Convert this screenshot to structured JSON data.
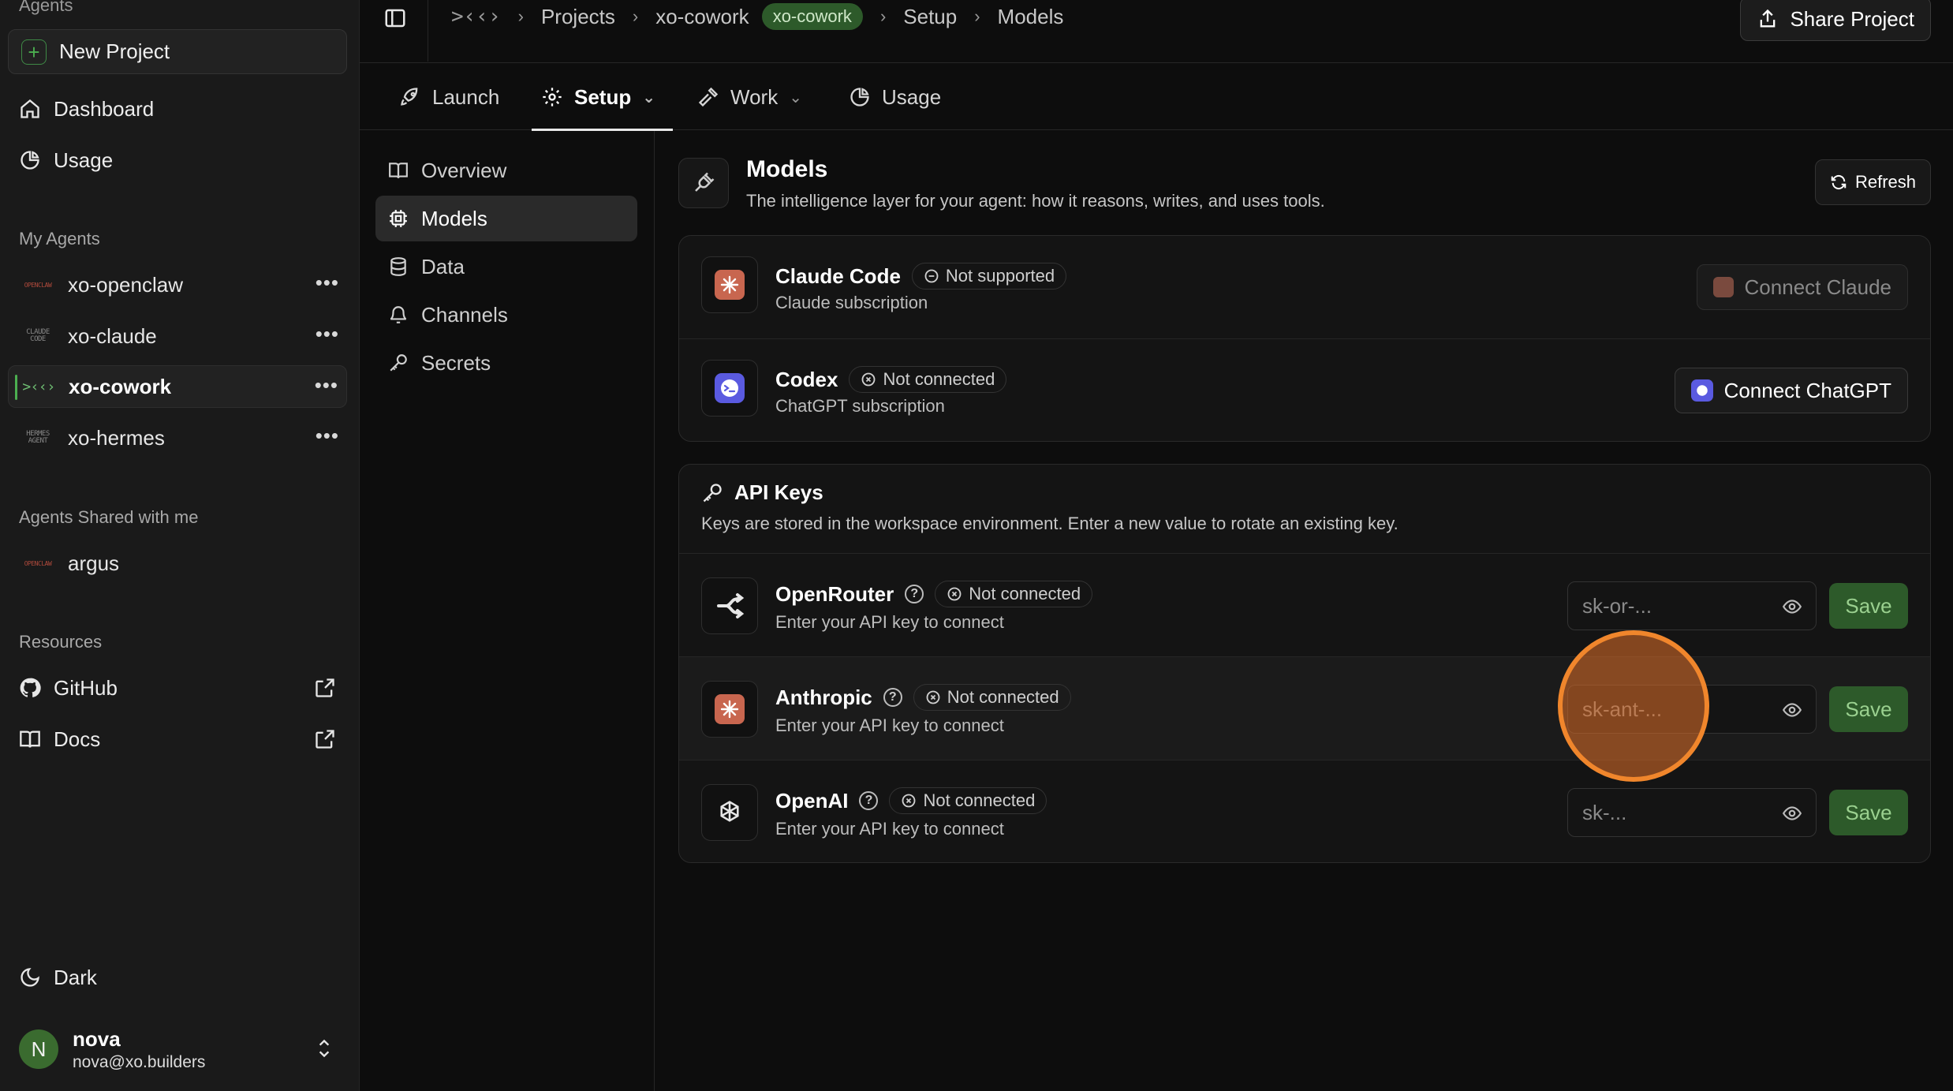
{
  "sidebar": {
    "top_heading": "Agents",
    "new_project": "New Project",
    "nav": [
      {
        "label": "Dashboard",
        "icon": "home-icon"
      },
      {
        "label": "Usage",
        "icon": "pie-chart-icon"
      }
    ],
    "my_agents_heading": "My Agents",
    "agents": [
      {
        "name": "xo-openclaw",
        "logo": "OPENCLAW"
      },
      {
        "name": "xo-claude",
        "logo": "CLAUDE CODE"
      },
      {
        "name": "xo-cowork",
        "logo": ">‹‹›"
      },
      {
        "name": "xo-hermes",
        "logo": "HERMES AGENT"
      }
    ],
    "shared_heading": "Agents Shared with me",
    "shared_agents": [
      {
        "name": "argus",
        "logo": "OPENCLAW"
      }
    ],
    "resources_heading": "Resources",
    "resources": [
      {
        "label": "GitHub",
        "icon": "github-icon"
      },
      {
        "label": "Docs",
        "icon": "book-icon"
      }
    ],
    "theme_label": "Dark",
    "user": {
      "initial": "N",
      "name": "nova",
      "email": "nova@xo.builders"
    }
  },
  "topbar": {
    "logo": ">‹‹›",
    "breadcrumbs": [
      "Projects",
      "xo-cowork",
      "Setup",
      "Models"
    ],
    "project_pill": "xo-cowork",
    "share_label": "Share Project"
  },
  "tabs": [
    {
      "label": "Launch",
      "icon": "rocket-icon"
    },
    {
      "label": "Setup",
      "icon": "gear-icon",
      "active": true
    },
    {
      "label": "Work",
      "icon": "hammer-icon"
    },
    {
      "label": "Usage",
      "icon": "pie-chart-icon"
    }
  ],
  "subnav": [
    {
      "label": "Overview",
      "icon": "book-icon"
    },
    {
      "label": "Models",
      "icon": "cpu-icon",
      "active": true
    },
    {
      "label": "Data",
      "icon": "database-icon"
    },
    {
      "label": "Channels",
      "icon": "bell-icon"
    },
    {
      "label": "Secrets",
      "icon": "key-icon"
    }
  ],
  "main": {
    "title": "Models",
    "subtitle": "The intelligence layer for your agent: how it reasons, writes, and uses tools.",
    "refresh_label": "Refresh",
    "subscriptions": [
      {
        "name": "Claude Code",
        "status": "Not supported",
        "subtitle": "Claude subscription",
        "action": "Connect Claude"
      },
      {
        "name": "Codex",
        "status": "Not connected",
        "subtitle": "ChatGPT subscription",
        "action": "Connect ChatGPT"
      }
    ],
    "api_keys": {
      "title": "API Keys",
      "subtitle": "Keys are stored in the workspace environment. Enter a new value to rotate an existing key.",
      "providers": [
        {
          "name": "OpenRouter",
          "status": "Not connected",
          "subtitle": "Enter your API key to connect",
          "placeholder": "sk-or-...",
          "save": "Save"
        },
        {
          "name": "Anthropic",
          "status": "Not connected",
          "subtitle": "Enter your API key to connect",
          "placeholder": "sk-ant-...",
          "save": "Save"
        },
        {
          "name": "OpenAI",
          "status": "Not connected",
          "subtitle": "Enter your API key to connect",
          "placeholder": "sk-...",
          "save": "Save"
        }
      ]
    }
  },
  "colors": {
    "accent_green": "#2d5a2a",
    "save_text": "#9ad08f",
    "claude_orange": "#c8664f",
    "codex_blue": "#5a5ae0",
    "click_marker": "#f0862c"
  }
}
